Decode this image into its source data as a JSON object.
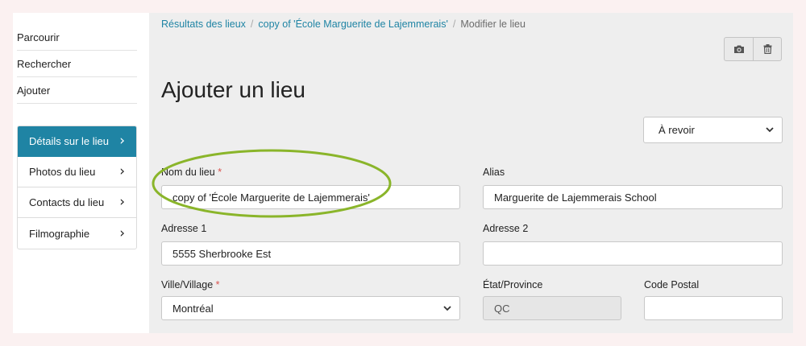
{
  "left_nav": {
    "items": [
      "Parcourir",
      "Rechercher",
      "Ajouter"
    ]
  },
  "detail_nav": {
    "items": [
      {
        "label": "Détails sur le lieu",
        "active": true
      },
      {
        "label": "Photos du lieu",
        "active": false
      },
      {
        "label": "Contacts du lieu",
        "active": false
      },
      {
        "label": "Filmographie",
        "active": false
      }
    ],
    "chevron": "›"
  },
  "breadcrumb": {
    "items": [
      "Résultats des lieux",
      "copy of 'École Marguerite de Lajemmerais'"
    ],
    "separator": "/",
    "current": "Modifier le lieu"
  },
  "toolbar": {
    "icons": [
      "camera-icon",
      "trash-icon"
    ]
  },
  "page_title": "Ajouter un lieu",
  "status_select": {
    "value": "À revoir"
  },
  "form": {
    "nom": {
      "label": "Nom du lieu",
      "required": "*",
      "value": "copy of 'École Marguerite de Lajemmerais'"
    },
    "alias": {
      "label": "Alias",
      "value": "Marguerite de Lajemmerais School"
    },
    "adresse1": {
      "label": "Adresse 1",
      "value": "5555 Sherbrooke Est"
    },
    "adresse2": {
      "label": "Adresse 2",
      "value": ""
    },
    "ville": {
      "label": "Ville/Village",
      "required": "*",
      "value": "Montréal"
    },
    "etat": {
      "label": "État/Province",
      "value": "QC"
    },
    "code_postal": {
      "label": "Code Postal",
      "value": ""
    }
  },
  "colors": {
    "accent": "#1f84a4",
    "highlight_ellipse": "#8ab52a",
    "required": "#d9534f"
  }
}
